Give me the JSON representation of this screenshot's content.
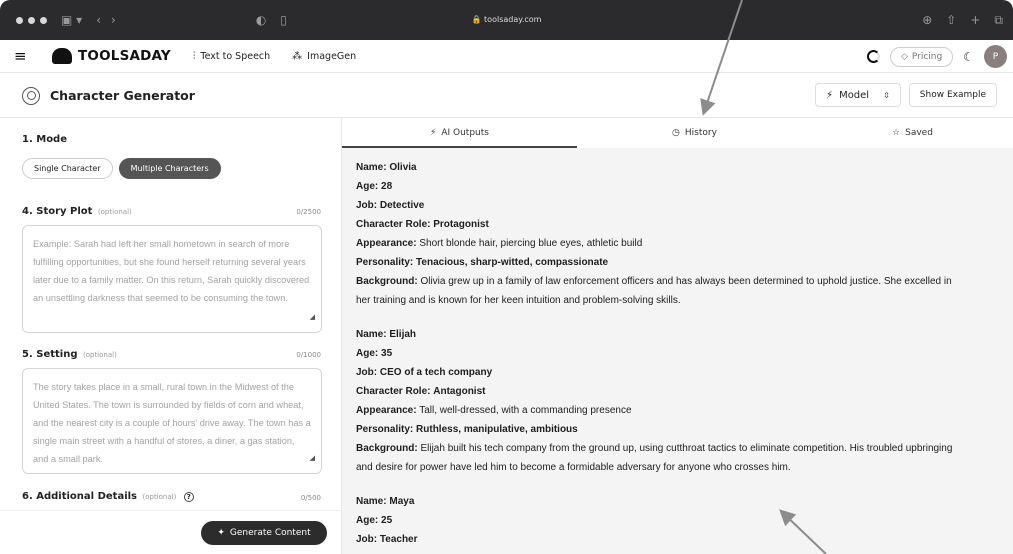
{
  "browser": {
    "url": "toolsaday.com"
  },
  "header": {
    "logo": "TOOLSADAY",
    "nav": [
      {
        "label": "Text to Speech"
      },
      {
        "label": "ImageGen"
      }
    ],
    "pricing": "Pricing",
    "avatar": "P"
  },
  "page": {
    "title": "Character Generator",
    "model_label": "Model",
    "show_example": "Show Example"
  },
  "form": {
    "mode": {
      "heading": "1. Mode",
      "options": [
        "Single Character",
        "Multiple Characters"
      ],
      "selected": "Multiple Characters"
    },
    "plot": {
      "heading": "4. Story Plot",
      "optional": "(optional)",
      "counter": "0/2500",
      "placeholder": "Example: Sarah had left her small hometown in search of more fulfilling opportunities, but she found herself returning several years later due to a family matter. On this return, Sarah quickly discovered an unsettling darkness that seemed to be consuming the town."
    },
    "setting": {
      "heading": "5. Setting",
      "optional": "(optional)",
      "counter": "0/1000",
      "placeholder": "The story takes place in a small, rural town in the Midwest of the United States. The town is surrounded by fields of corn and wheat, and the nearest city is a couple of hours' drive away. The town has a single main street with a handful of stores, a diner, a gas station, and a small park."
    },
    "details": {
      "heading": "6. Additional Details",
      "optional": "(optional)",
      "counter": "0/500"
    },
    "generate": "Generate Content"
  },
  "tabs": [
    {
      "label": "AI Outputs"
    },
    {
      "label": "History"
    },
    {
      "label": "Saved"
    }
  ],
  "characters": [
    {
      "name": "Olivia",
      "age": "28",
      "job": "Detective",
      "role": "Protagonist",
      "appearance": "Short blonde hair, piercing blue eyes, athletic build",
      "personality": "Tenacious, sharp-witted, compassionate",
      "background_l1": "Olivia grew up in a family of law enforcement officers and has always been determined to uphold justice. She excelled in",
      "background_l2": "her training and is known for her keen intuition and problem-solving skills."
    },
    {
      "name": "Elijah",
      "age": "35",
      "job": "CEO of a tech company",
      "role": "Antagonist",
      "appearance": "Tall, well-dressed, with a commanding presence",
      "personality": "Ruthless, manipulative, ambitious",
      "background_l1": "Elijah built his tech company from the ground up, using cutthroat tactics to eliminate competition. His troubled upbringing",
      "background_l2": "and desire for power have led him to become a formidable adversary for anyone who crosses him."
    },
    {
      "name": "Maya",
      "age": "25",
      "job": "Teacher"
    }
  ],
  "labels": {
    "name": "Name:",
    "age": "Age:",
    "job": "Job:",
    "role": "Character Role:",
    "appearance": "Appearance:",
    "personality": "Personality:",
    "background": "Background:"
  }
}
